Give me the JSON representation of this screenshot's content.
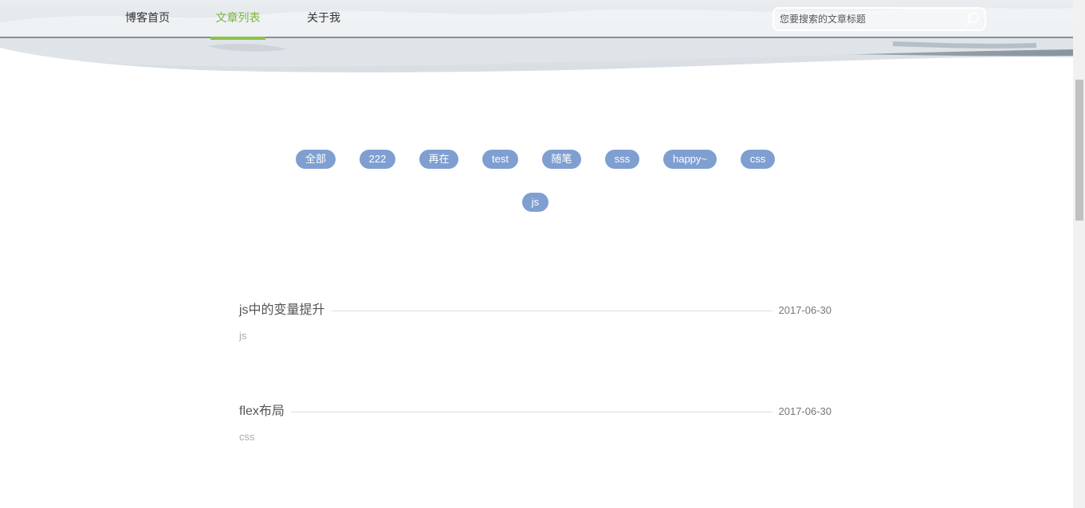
{
  "nav": {
    "items": [
      {
        "label": "博客首页",
        "active": false
      },
      {
        "label": "文章列表",
        "active": true
      },
      {
        "label": "关于我",
        "active": false
      }
    ],
    "search": {
      "placeholder": "您要搜索的文章标题",
      "value": ""
    },
    "accent_color": "#8bc34a"
  },
  "tags": {
    "color": "#7f9fd1",
    "items": [
      "全部",
      "222",
      "再在",
      "test",
      "随笔",
      "sss",
      "happy~",
      "css",
      "js"
    ]
  },
  "articles": [
    {
      "title": "js中的变量提升",
      "date": "2017-06-30",
      "tag": "js"
    },
    {
      "title": "flex布局",
      "date": "2017-06-30",
      "tag": "css"
    }
  ]
}
